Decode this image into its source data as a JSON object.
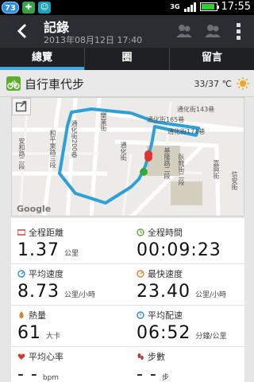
{
  "status_bar": {
    "badges": [
      "73",
      "",
      ""
    ],
    "network": "3G",
    "time": "17:55"
  },
  "header": {
    "title": "記錄",
    "subtitle": "2013年08月12日 17:40"
  },
  "tabs": [
    {
      "label": "總覽",
      "active": true
    },
    {
      "label": "圈",
      "active": false
    },
    {
      "label": "留言",
      "active": false
    }
  ],
  "activity": {
    "title": "自行車代步",
    "weather": "33/37 ℃"
  },
  "map": {
    "google_label": "Google",
    "streets": [
      "通化街143巷",
      "通化街165巷",
      "通化街171巷",
      "通化街200巷",
      "臥龍街二段",
      "和平東路三段",
      "安和路二段",
      "樂業街",
      "通化街",
      "基隆路二段",
      "嘉興街",
      "信安街"
    ]
  },
  "stats": [
    {
      "label": "全程距離",
      "value": "1.37",
      "unit": "公里",
      "icon": "ruler-icon",
      "color": "#d9342b"
    },
    {
      "label": "全程時間",
      "value": "00:09:23",
      "unit": "",
      "icon": "clock-icon",
      "color": "#5eae2e"
    },
    {
      "label": "平均速度",
      "value": "8.73",
      "unit": "公里/小時",
      "icon": "speed-icon",
      "color": "#2b8be0"
    },
    {
      "label": "最快速度",
      "value": "23.40",
      "unit": "公里/小時",
      "icon": "speed-max-icon",
      "color": "#e0822b"
    },
    {
      "label": "熱量",
      "value": "61",
      "unit": "大卡",
      "icon": "flame-icon",
      "color": "#e0822b"
    },
    {
      "label": "平均配速",
      "value": "06:52",
      "unit": "分鐘/公里",
      "icon": "pace-icon",
      "color": "#2b8be0"
    },
    {
      "label": "平均心率",
      "value": "- -",
      "unit": "bpm",
      "icon": "heart-icon",
      "color": "#d9342b"
    },
    {
      "label": "步數",
      "value": "- -",
      "unit": "步",
      "icon": "footstep-icon",
      "color": "#b33"
    }
  ],
  "colors": {
    "accent": "#3fa9e5",
    "route": "#2f9fd8"
  }
}
